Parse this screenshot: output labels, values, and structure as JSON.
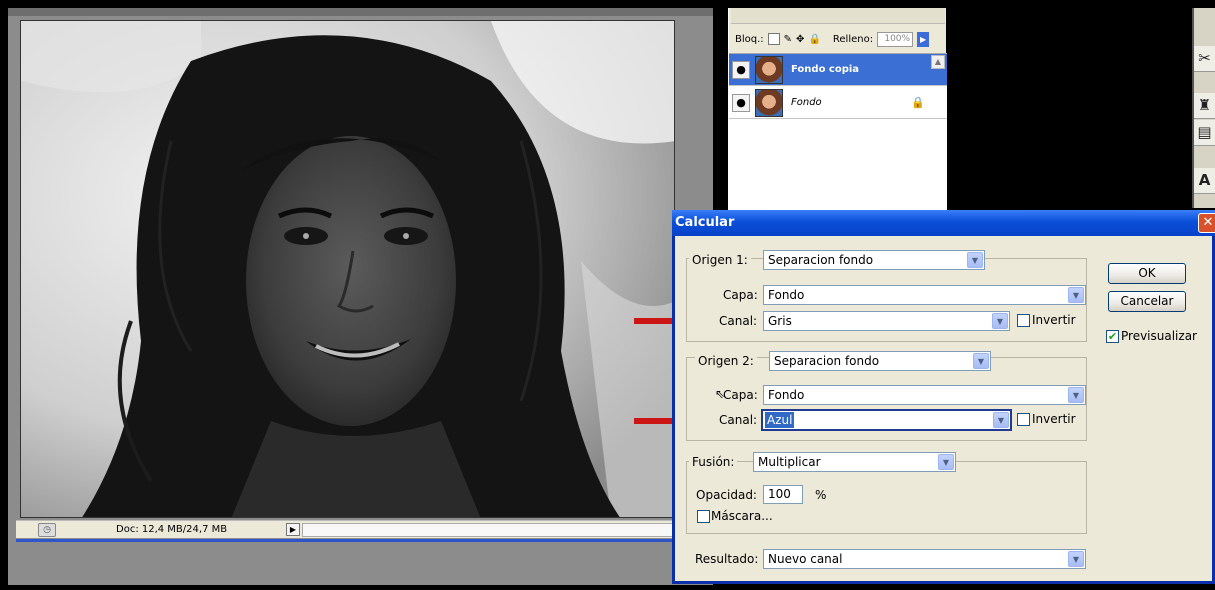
{
  "document": {
    "status_doc_size": "Doc: 12,4 MB/24,7 MB",
    "status_arrow": "▶"
  },
  "layers": {
    "lock_label": "Bloq.:",
    "fill_label": "Relleno:",
    "fill_value": "100%",
    "fill_btn": "▶",
    "items": [
      {
        "name": "Fondo copia",
        "eye": "●",
        "lock": ""
      },
      {
        "name": "Fondo",
        "eye": "●",
        "lock": "🔒"
      }
    ]
  },
  "toolbar": {
    "icons": [
      "scissors-icon",
      "stamp-icon",
      "history-icon",
      "type-icon"
    ],
    "glyphs": [
      "✂",
      "♜",
      "▤",
      "A"
    ]
  },
  "dialog": {
    "title": "Calcular",
    "close": "✕",
    "origen1": {
      "label": "Origen 1:",
      "value": "Separacion fondo",
      "capa_label": "Capa:",
      "capa_value": "Fondo",
      "canal_label": "Canal:",
      "canal_value": "Gris",
      "invertir_label": "Invertir",
      "invertir_checked": false
    },
    "origen2": {
      "label": "Origen 2:",
      "value": "Separacion fondo",
      "capa_label": "Capa:",
      "capa_value": "Fondo",
      "canal_label": "Canal:",
      "canal_value": "Azul",
      "invertir_label": "Invertir",
      "invertir_checked": false
    },
    "fusion": {
      "label": "Fusión:",
      "value": "Multiplicar",
      "opacidad_label": "Opacidad:",
      "opacidad_value": "100",
      "percent": "%",
      "mascara_label": "Máscara...",
      "mascara_checked": false
    },
    "resultado": {
      "label": "Resultado:",
      "value": "Nuevo canal"
    },
    "ok_label": "OK",
    "cancel_label": "Cancelar",
    "preview_label": "Previsualizar",
    "preview_checked": true,
    "dropdown_glyph": "▼",
    "check_glyph": "✔"
  },
  "colors": {
    "selection_blue": "#316ac5",
    "arrow_red": "#cc1515",
    "title_blue": "#0a4fd8"
  }
}
